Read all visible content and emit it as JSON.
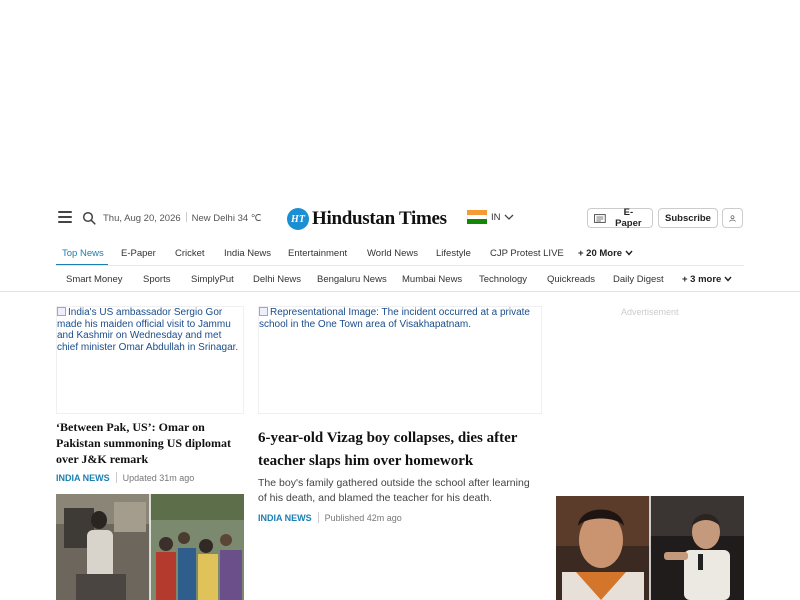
{
  "header": {
    "date": "Thu, Aug 20, 2026",
    "location_weather": "New Delhi 34 ℃",
    "logo_badge": "HT",
    "logo_text": "Hindustan Times",
    "edition": "IN",
    "epaper_label": "E-Paper",
    "subscribe_label": "Subscribe",
    "icons": [
      "hamburger-menu-icon",
      "search-icon",
      "chevron-down-icon",
      "newspaper-icon",
      "user-icon"
    ]
  },
  "nav_primary": {
    "items": [
      "Top News",
      "E-Paper",
      "Cricket",
      "India News",
      "Entertainment",
      "World News",
      "Lifestyle",
      "CJP Protest LIVE"
    ],
    "more": "+ 20 More"
  },
  "nav_secondary": {
    "items": [
      "Smart Money",
      "Sports",
      "SimplyPut",
      "Delhi News",
      "Bengaluru News",
      "Mumbai News",
      "Technology",
      "Quickreads",
      "Daily Digest"
    ],
    "more": "+ 3 more"
  },
  "col1": {
    "image_alt": "India's US ambassador Sergio Gor made his maiden official visit to Jammu and Kashmir on Wednesday and met chief minister Omar Abdullah in Srinagar.",
    "headline": "‘Between Pak, US’: Omar on Pakistan summoning US diplomat over J&K remark",
    "category": "INDIA NEWS",
    "time": "Updated 31m ago"
  },
  "col2": {
    "image_alt": "Representational Image: The incident occurred at a private school in the One Town area of Visakhapatnam.",
    "headline": "6-year-old Vizag boy collapses, dies after teacher slaps him over homework",
    "summary": "The boy's family gathered outside the school after learning of his death, and blamed the teacher for his death.",
    "category": "INDIA NEWS",
    "time": "Published 42m ago"
  },
  "advertisement_label": "Advertisement",
  "colors": {
    "accent": "#1b7fb3",
    "logo_blue": "#1b8fd1",
    "flag_saffron": "#f59a34",
    "flag_green": "#138808"
  }
}
